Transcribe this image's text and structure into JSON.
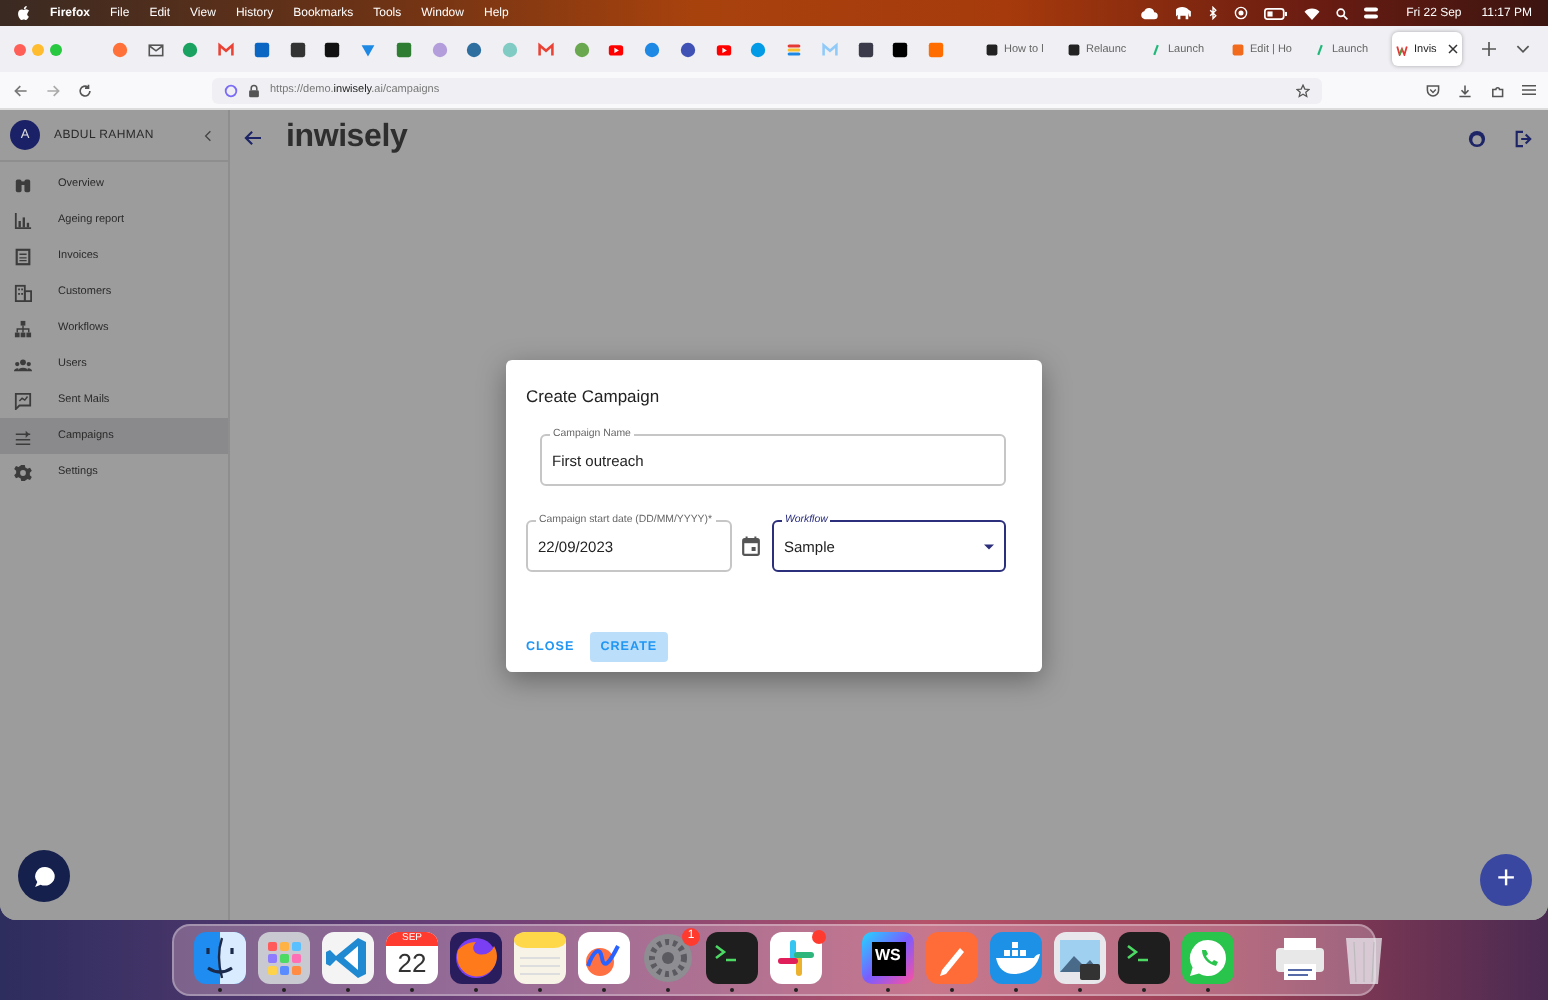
{
  "menu_bar": {
    "app_name": "Firefox",
    "menus": [
      "File",
      "Edit",
      "View",
      "History",
      "Bookmarks",
      "Tools",
      "Window",
      "Help"
    ],
    "date": "Fri 22 Sep",
    "time": "11:17 PM"
  },
  "browser": {
    "tabs": [
      {
        "label": "How to l",
        "selected": false
      },
      {
        "label": "Relaunc",
        "selected": false
      },
      {
        "label": "Launch",
        "selected": false
      },
      {
        "label": "Edit | Ho",
        "selected": false
      },
      {
        "label": "Launch",
        "selected": false
      },
      {
        "label": "Invis",
        "selected": true
      }
    ],
    "url": "https://demo.**inwisely**.ai/campaigns"
  },
  "sidebar": {
    "avatar": "A",
    "user": "ABDUL RAHMAN",
    "items": [
      {
        "label": "Overview",
        "selected": false
      },
      {
        "label": "Ageing report",
        "selected": false
      },
      {
        "label": "Invoices",
        "selected": false
      },
      {
        "label": "Customers",
        "selected": false
      },
      {
        "label": "Workflows",
        "selected": false
      },
      {
        "label": "Users",
        "selected": false
      },
      {
        "label": "Sent Mails",
        "selected": false
      },
      {
        "label": "Campaigns",
        "selected": true
      },
      {
        "label": "Settings",
        "selected": false
      }
    ]
  },
  "header": {
    "logo": "inwisely"
  },
  "dialog": {
    "title": "Create Campaign",
    "fields": [
      {
        "kind": "text",
        "label": "Campaign Name",
        "value": "First outreach",
        "focused": false
      },
      {
        "kind": "date",
        "label": "Campaign start date (DD/MM/YYYY)*",
        "value": "22/09/2023",
        "focused": false
      },
      {
        "kind": "select",
        "label": "Workflow",
        "value": "Sample",
        "focused": true
      }
    ],
    "buttons": [
      {
        "kind": "text",
        "label": "CLOSE"
      },
      {
        "kind": "contained",
        "label": "CREATE"
      }
    ]
  },
  "fab": {
    "label": "+"
  },
  "dock": [
    {
      "kind": "finder",
      "running": true
    },
    {
      "kind": "launchpad",
      "running": true
    },
    {
      "kind": "vscode",
      "running": true
    },
    {
      "kind": "calendar",
      "month": "SEP",
      "day": "22",
      "running": true
    },
    {
      "kind": "firefox",
      "running": true
    },
    {
      "kind": "notes",
      "running": true
    },
    {
      "kind": "freeform",
      "running": true
    },
    {
      "kind": "settings",
      "badge": "1",
      "running": true
    },
    {
      "kind": "terminal",
      "running": true
    },
    {
      "kind": "slack",
      "badge_dot": true,
      "running": true
    },
    {
      "kind": "separator"
    },
    {
      "kind": "webstorm",
      "initials": "WS",
      "running": true
    },
    {
      "kind": "postman",
      "running": true
    },
    {
      "kind": "docker",
      "running": true
    },
    {
      "kind": "preview",
      "running": true
    },
    {
      "kind": "terminal",
      "running": true
    },
    {
      "kind": "whatsapp",
      "running": true
    },
    {
      "kind": "separator"
    },
    {
      "kind": "printer",
      "running": false
    },
    {
      "kind": "trash",
      "running": false
    }
  ]
}
